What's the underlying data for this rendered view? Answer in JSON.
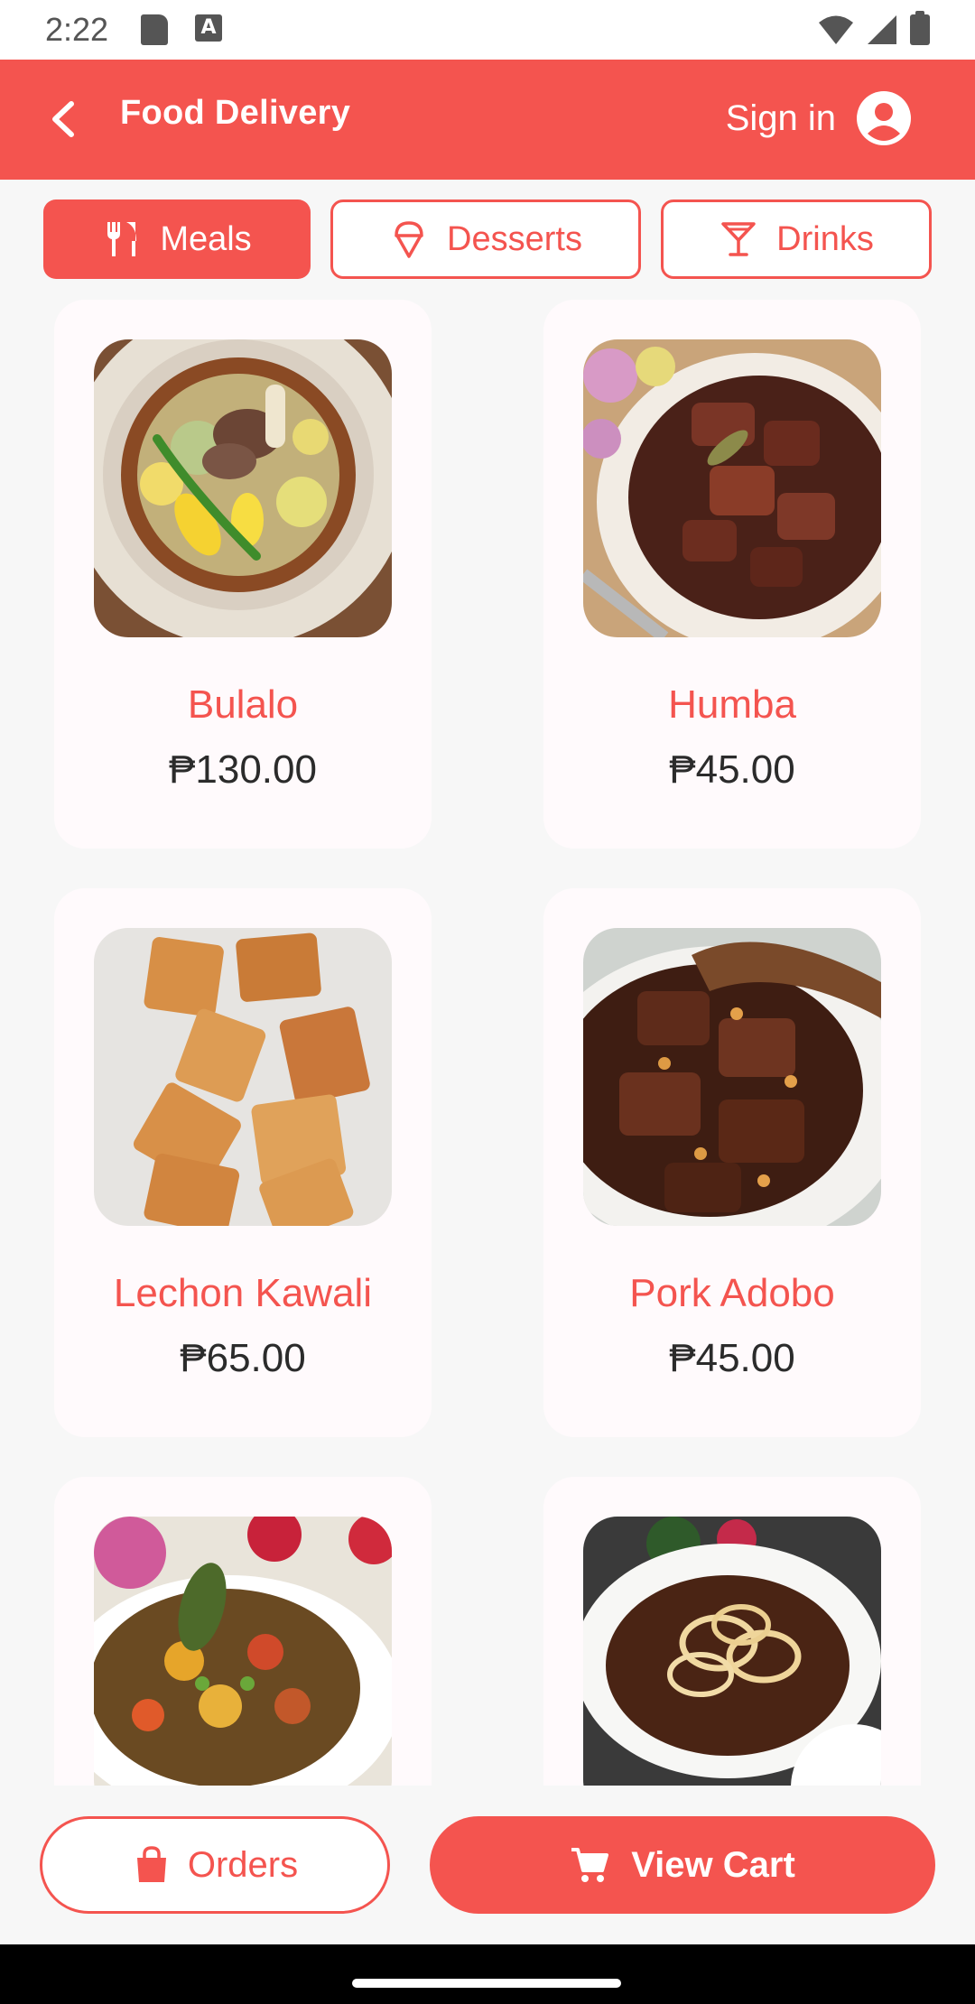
{
  "status_bar": {
    "time": "2:22",
    "a_badge": "A"
  },
  "app_bar": {
    "title": "Food Delivery",
    "sign_in_label": "Sign in"
  },
  "tabs": [
    {
      "label": "Meals",
      "icon": "fork-knife-icon",
      "selected": true
    },
    {
      "label": "Desserts",
      "icon": "ice-cream-icon",
      "selected": false
    },
    {
      "label": "Drinks",
      "icon": "cocktail-icon",
      "selected": false
    }
  ],
  "menu_items": [
    {
      "name": "Bulalo",
      "price": "₱130.00"
    },
    {
      "name": "Humba",
      "price": "₱45.00"
    },
    {
      "name": "Lechon Kawali",
      "price": "₱65.00"
    },
    {
      "name": "Pork Adobo",
      "price": "₱45.00"
    },
    {
      "name": "",
      "price": ""
    },
    {
      "name": "",
      "price": ""
    }
  ],
  "actions": {
    "orders_label": "Orders",
    "cart_label": "View Cart"
  },
  "colors": {
    "accent": "#f4544f",
    "background": "#f7f7f7",
    "card": "#fffafc"
  }
}
